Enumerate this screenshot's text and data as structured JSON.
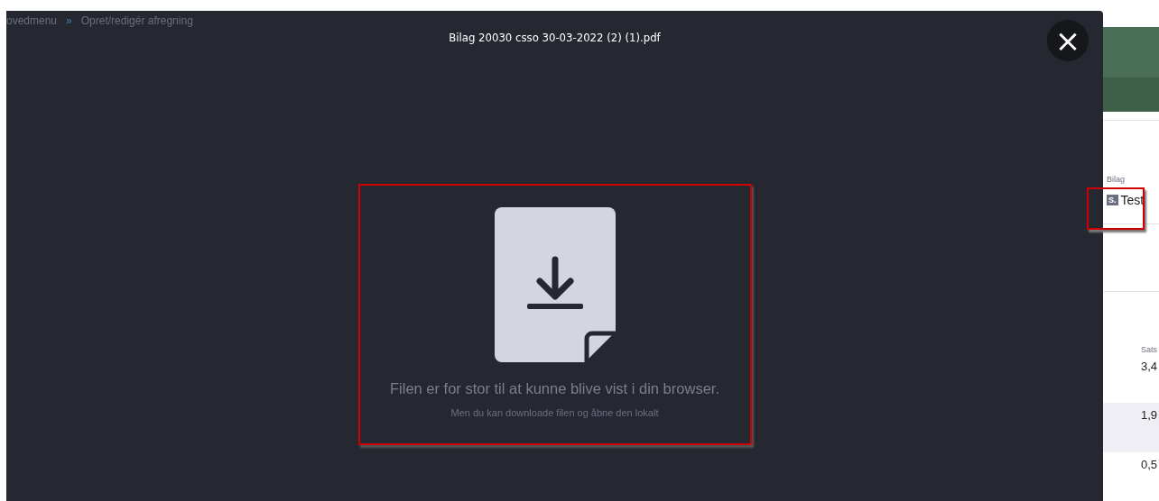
{
  "breadcrumb": {
    "items": [
      "ovedmenu",
      "Opret/redigér afregning"
    ],
    "separator": "»"
  },
  "viewer": {
    "title": "Bilag 20030 csso 30-03-2022 (2) (1).pdf",
    "close_label": "×",
    "message": "Filen er for stor til at kunne blive vist i din browser.",
    "hint": "Men du kan downloade filen og åbne den lokalt"
  },
  "background": {
    "attachment_label": "Bilag",
    "attachment_icon": "S.",
    "attachment_name": "Test",
    "column_label": "Sats",
    "rows": [
      {
        "value": "3,4",
        "highlighted": false
      },
      {
        "value": "1,9",
        "highlighted": true
      },
      {
        "value": "0,5",
        "highlighted": false
      }
    ]
  }
}
